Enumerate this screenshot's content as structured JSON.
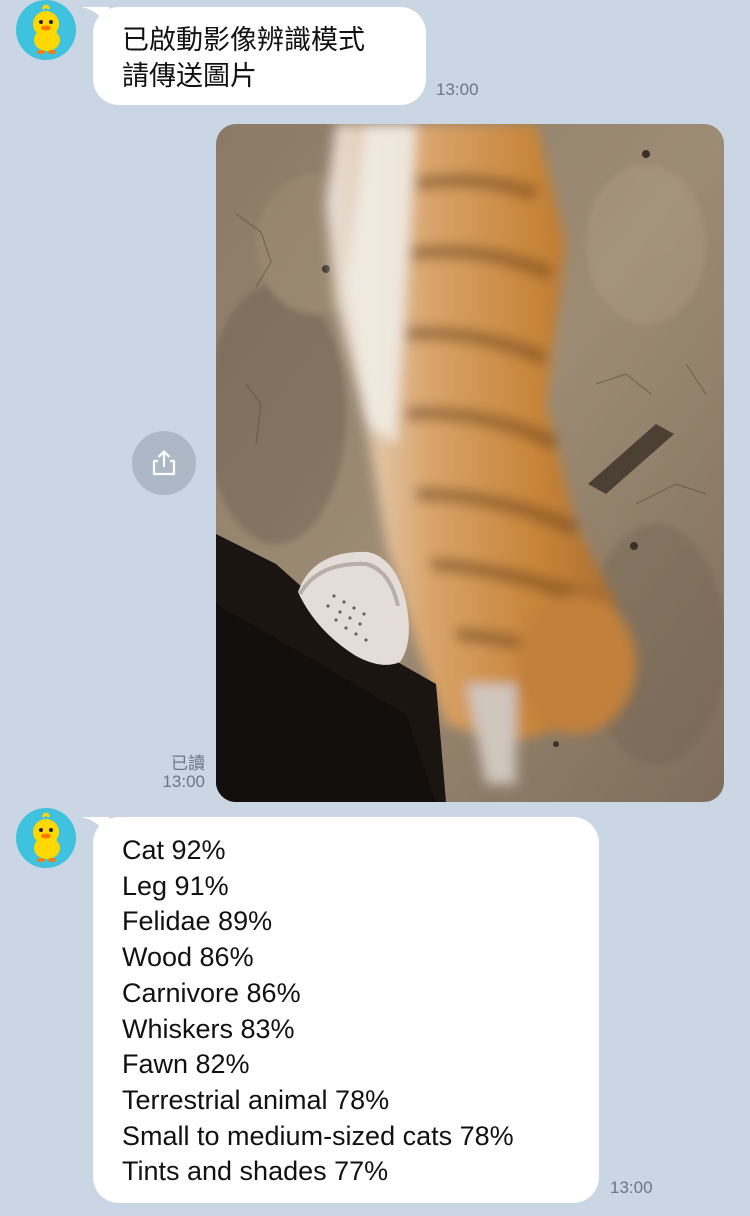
{
  "messages": {
    "first": {
      "lines": [
        "已啟動影像辨識模式",
        "請傳送圖片"
      ],
      "time": "13:00"
    },
    "photo": {
      "read_label": "已讀",
      "time": "13:00"
    },
    "results": {
      "lines": [
        "Cat 92%",
        "Leg 91%",
        "Felidae 89%",
        "Wood 86%",
        "Carnivore 86%",
        "Whiskers 83%",
        "Fawn 82%",
        "Terrestrial animal 78%",
        "Small to medium-sized cats 78%",
        "Tints and shades 77%"
      ],
      "time": "13:00"
    }
  },
  "icons": {
    "avatar": "duck-avatar-icon",
    "share": "share-icon"
  },
  "colors": {
    "background": "#cbd6e4",
    "bubble": "#ffffff",
    "avatar_bg": "#3ec2dd"
  }
}
